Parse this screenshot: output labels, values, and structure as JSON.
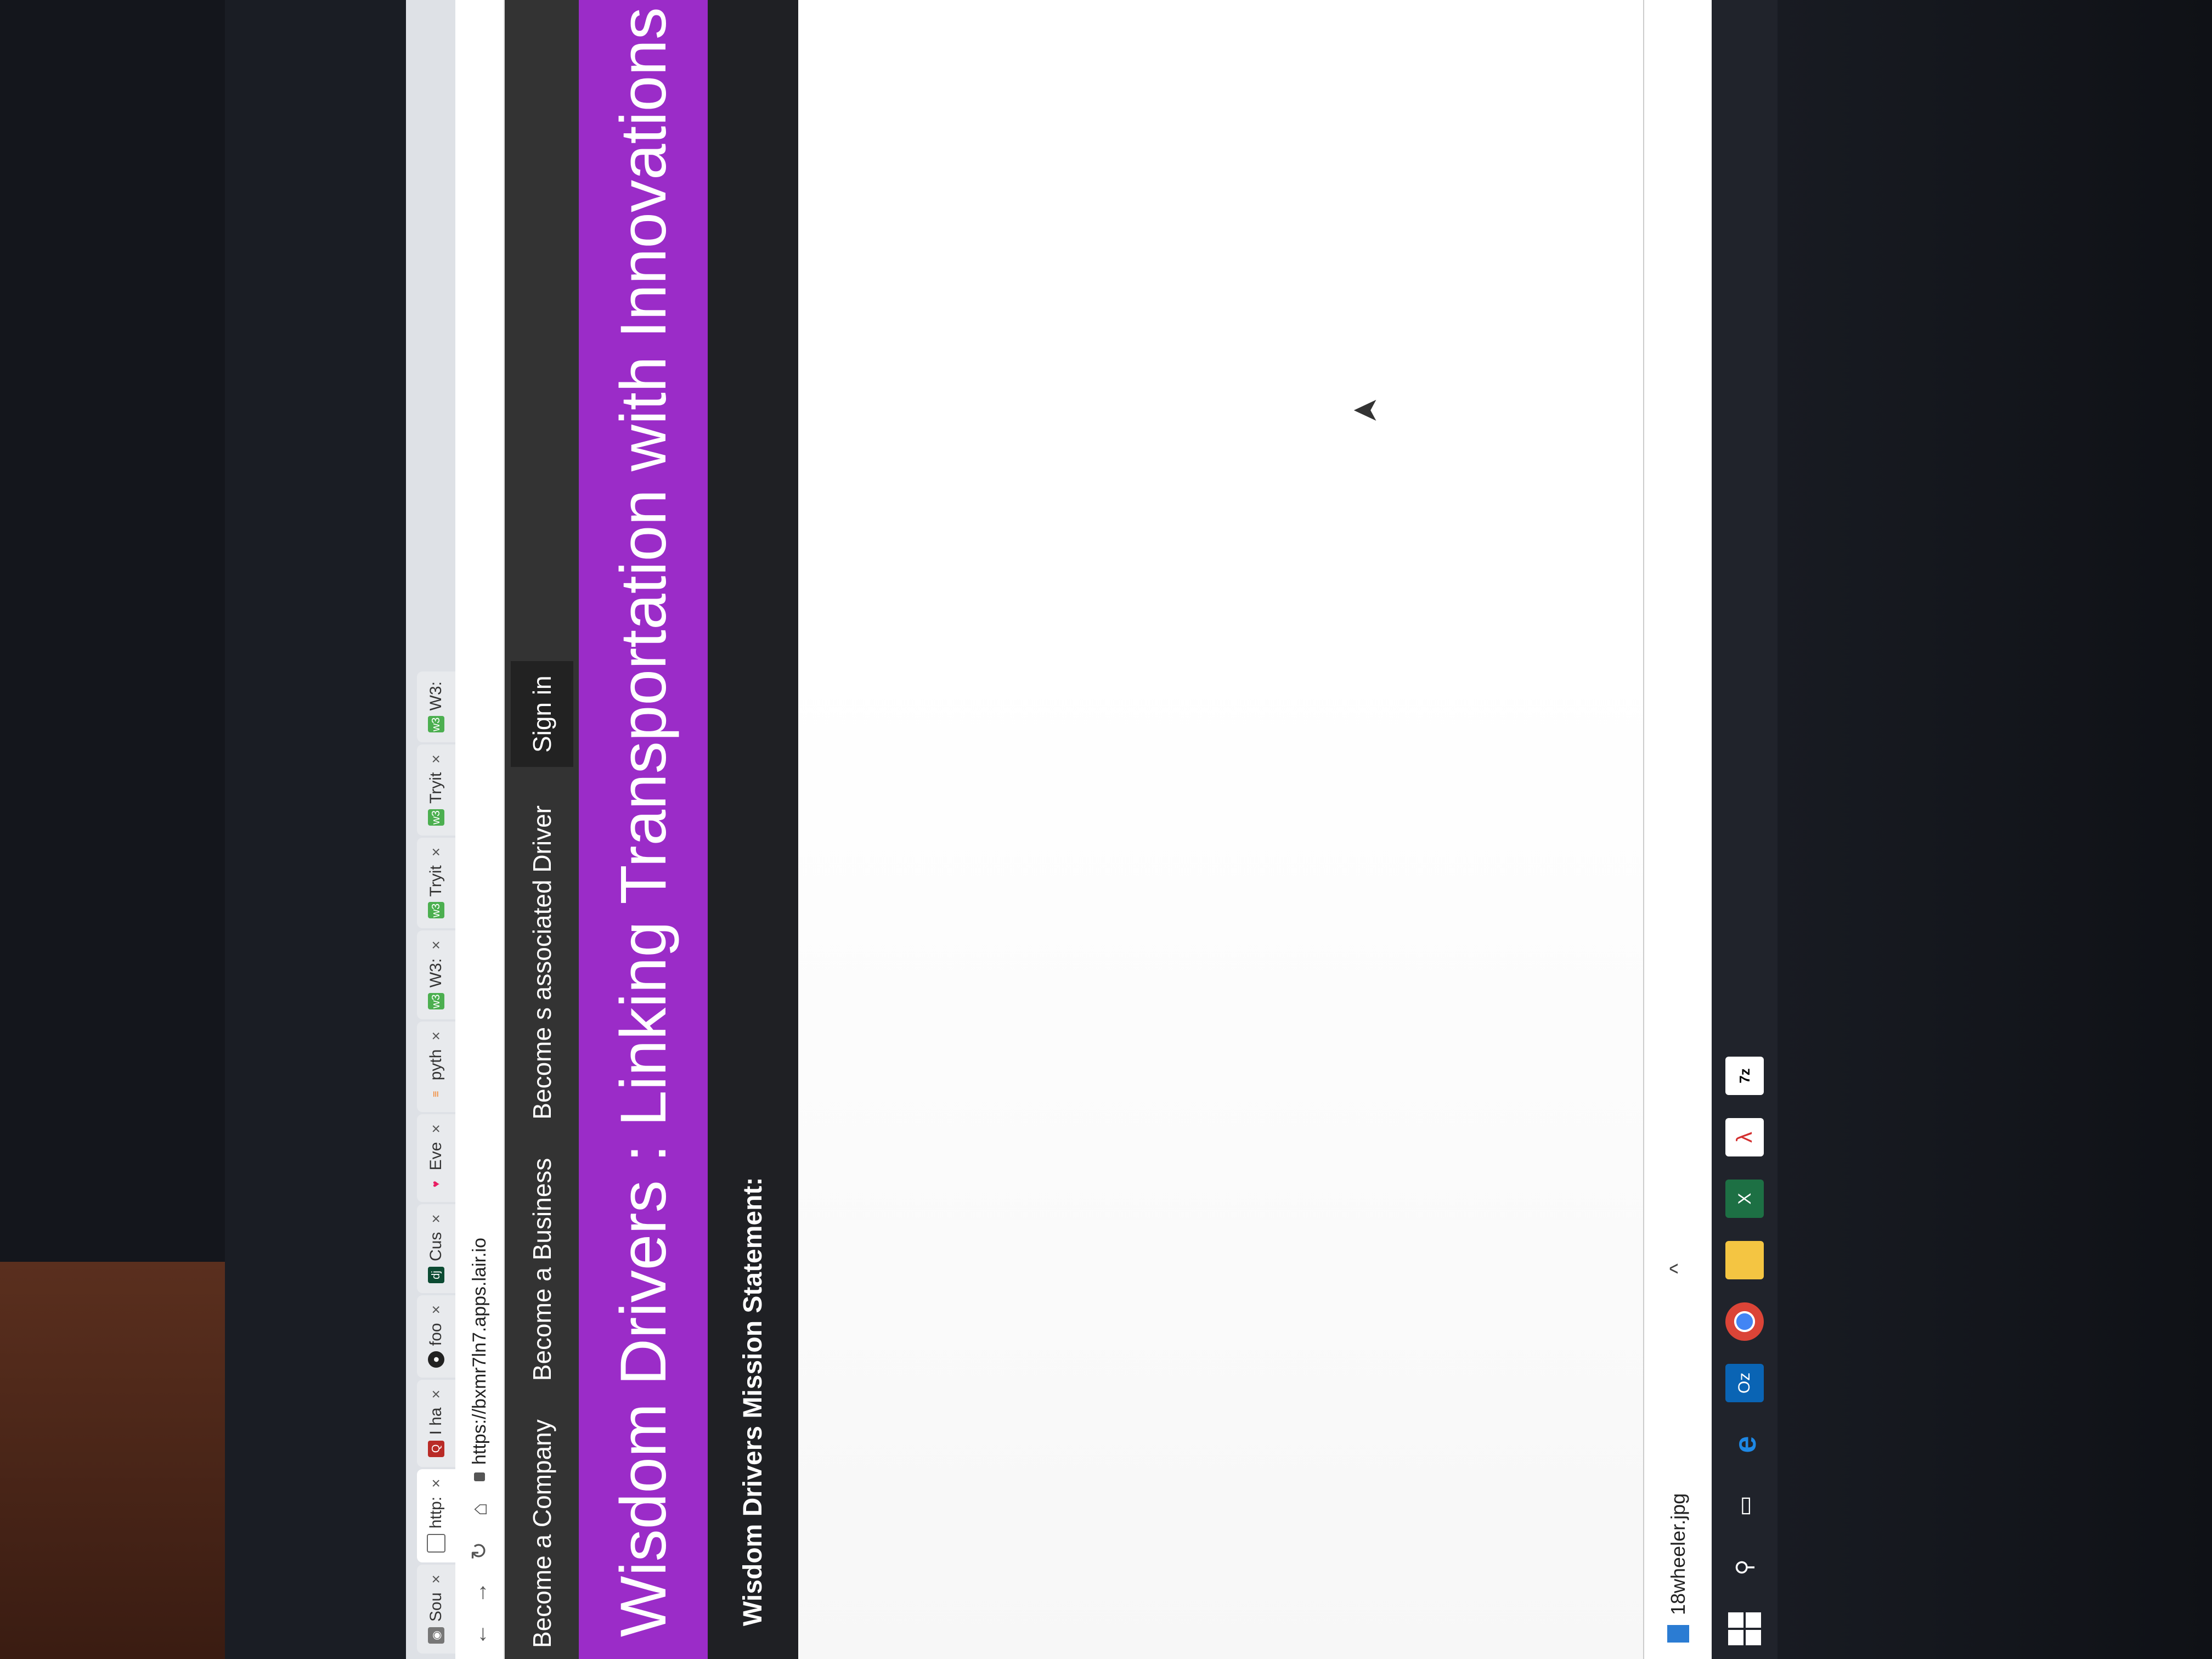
{
  "browser": {
    "tabs": [
      {
        "label": "Sou",
        "icon": "sound-icon"
      },
      {
        "label": "http:",
        "icon": "page-icon"
      },
      {
        "label": "I ha",
        "icon": "quora-icon"
      },
      {
        "label": "foo",
        "icon": "github-icon"
      },
      {
        "label": "Cus",
        "icon": "django-icon"
      },
      {
        "label": "Eve",
        "icon": "heart-icon"
      },
      {
        "label": "pyth",
        "icon": "stack-icon"
      },
      {
        "label": "W3:",
        "icon": "w3schools-icon"
      },
      {
        "label": "Tryit",
        "icon": "w3schools-icon"
      },
      {
        "label": "Tryit",
        "icon": "w3schools-icon"
      },
      {
        "label": "W3:",
        "icon": "w3schools-icon"
      }
    ],
    "close_glyph": "×",
    "url": "https://bxmr7ln7.apps.lair.io"
  },
  "nav": {
    "items": [
      "Become a Company",
      "Become a Business",
      "Become s associated Driver"
    ],
    "signin": "Sign in"
  },
  "hero": {
    "title": "Wisdom Drivers : Linking Transportation with Innovations"
  },
  "mission": {
    "heading": "Wisdom Drivers Mission Statement:"
  },
  "download": {
    "filename": "18wheeler.jpg",
    "chevron": "^"
  },
  "taskbar": {
    "outlook_label": "Oz",
    "excel_label": "X",
    "acrobat_label": "λ",
    "sevenzip_label": "7z"
  },
  "colors": {
    "hero_bg": "#9b2cc8",
    "nav_bg": "#333333",
    "mission_bg": "#1f2024"
  }
}
